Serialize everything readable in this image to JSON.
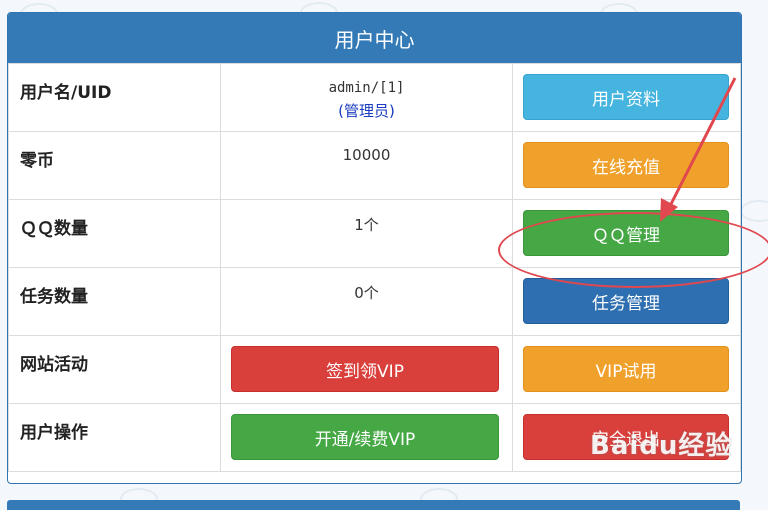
{
  "panel": {
    "title": "用户中心",
    "rows": [
      {
        "label": "用户名/UID",
        "value": "admin/[1]",
        "role": "(管理员)",
        "button": "用户资料"
      },
      {
        "label": "零币",
        "value": "10000",
        "button": "在线充值"
      },
      {
        "label": "ＱＱ数量",
        "value": "1个",
        "button": "ＱＱ管理"
      },
      {
        "label": "任务数量",
        "value": "0个",
        "button": "任务管理"
      },
      {
        "label": "网站活动",
        "wide_button": "签到领VIP",
        "button": "VIP试用"
      },
      {
        "label": "用户操作",
        "wide_button": "开通/续费VIP",
        "button": "安全退出"
      }
    ]
  },
  "watermark": "Baidu经验",
  "colors": {
    "header": "#337ab7",
    "info": "#45b5df",
    "warning": "#f0a12b",
    "success": "#45a845",
    "primary": "#2d6fb0",
    "danger": "#d93f3b",
    "annotation": "#e0474f"
  }
}
